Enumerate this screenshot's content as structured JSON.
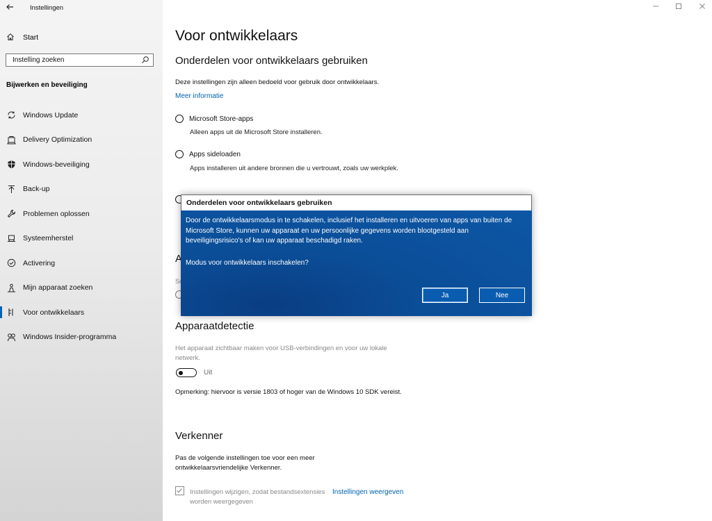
{
  "window": {
    "title": "Instellingen"
  },
  "sidebar": {
    "home_label": "Start",
    "search_placeholder": "Instelling zoeken",
    "section_title": "Bijwerken en beveiliging",
    "items": [
      {
        "label": "Windows Update",
        "icon": "sync-icon"
      },
      {
        "label": "Delivery Optimization",
        "icon": "delivery-icon"
      },
      {
        "label": "Windows-beveiliging",
        "icon": "shield-icon"
      },
      {
        "label": "Back-up",
        "icon": "upload-icon"
      },
      {
        "label": "Problemen oplossen",
        "icon": "wrench-icon"
      },
      {
        "label": "Systeemherstel",
        "icon": "laptop-icon"
      },
      {
        "label": "Activering",
        "icon": "check-circle-icon"
      },
      {
        "label": "Mijn apparaat zoeken",
        "icon": "person-pin-icon"
      },
      {
        "label": "Voor ontwikkelaars",
        "icon": "developer-icon"
      },
      {
        "label": "Windows Insider-programma",
        "icon": "insider-icon"
      }
    ]
  },
  "main": {
    "page_title": "Voor ontwikkelaars",
    "section_use": "Onderdelen voor ontwikkelaars gebruiken",
    "use_desc": "Deze instellingen zijn alleen bedoeld voor gebruik door ontwikkelaars.",
    "more_info": "Meer informatie",
    "options": [
      {
        "label": "Microsoft Store-apps",
        "desc": "Alleen apps uit de Microsoft Store installeren."
      },
      {
        "label": "Apps sideloaden",
        "desc": "Apps installeren uit andere bronnen die u vertrouwt, zoals uw werkplek."
      }
    ],
    "partial_a": "A",
    "partial_s": "So",
    "section_detect": "Apparaatdetectie",
    "detect_desc": "Het apparaat zichtbaar maken voor USB-verbindingen en voor uw lokale netwerk.",
    "toggle_label": "Uit",
    "detect_note": "Opmerking: hiervoor is versie 1803 of hoger van de Windows 10 SDK vereist.",
    "section_explorer": "Verkenner",
    "explorer_desc": "Pas de volgende instellingen toe voor een meer ontwikkelaarsvriendelijke Verkenner.",
    "checkbox_label": "Instellingen wijzigen, zodat bestandsextensies worden weergegeven",
    "show_settings": "Instellingen weergeven"
  },
  "dialog": {
    "title": "Onderdelen voor ontwikkelaars gebruiken",
    "message": "Door de ontwikkelaarsmodus in te schakelen, inclusief het installeren en uitvoeren van apps van buiten de Microsoft Store, kunnen uw apparaat en uw persoonlijke gegevens worden blootgesteld aan beveiligingsrisico's of kan uw apparaat beschadigd raken.",
    "question": "Modus voor ontwikkelaars inschakelen?",
    "yes": "Ja",
    "no": "Nee"
  }
}
